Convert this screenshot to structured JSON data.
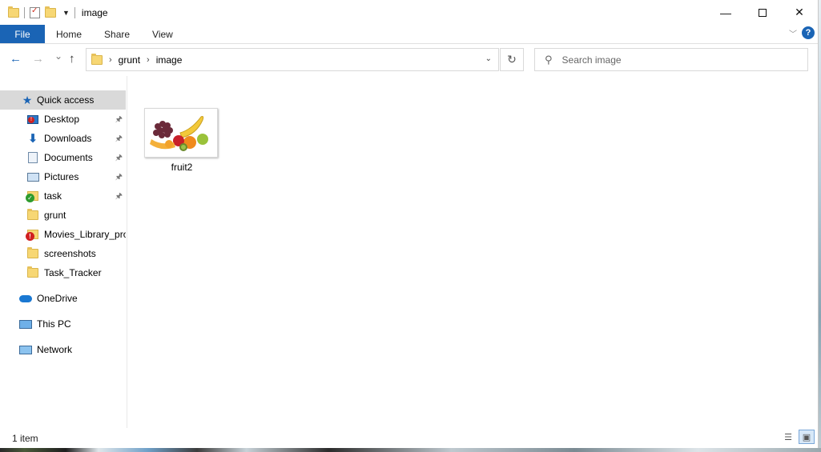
{
  "window": {
    "title": "image",
    "controls": {
      "minimize": "—",
      "maximize": "",
      "close": "✕"
    }
  },
  "ribbon": {
    "tabs": [
      "File",
      "Home",
      "Share",
      "View"
    ],
    "expand_icon": "chevron-down-icon",
    "help": "?"
  },
  "navigation": {
    "back": "←",
    "forward": "→",
    "recent": "⌄",
    "up": "↑",
    "path": [
      "grunt",
      "image"
    ],
    "separator": "›",
    "refresh": "↻",
    "search_placeholder": "Search image",
    "search_icon": "⚲"
  },
  "sidebar": {
    "quick_access": "Quick access",
    "items": [
      {
        "label": "Desktop",
        "pinned": true
      },
      {
        "label": "Downloads",
        "pinned": true
      },
      {
        "label": "Documents",
        "pinned": true
      },
      {
        "label": "Pictures",
        "pinned": true
      },
      {
        "label": "task",
        "pinned": true
      },
      {
        "label": "grunt",
        "pinned": false
      },
      {
        "label": "Movies_Library_pro",
        "pinned": false
      },
      {
        "label": "screenshots",
        "pinned": false
      },
      {
        "label": "Task_Tracker",
        "pinned": false
      }
    ],
    "onedrive": "OneDrive",
    "this_pc": "This PC",
    "network": "Network",
    "pin_glyph": "📌"
  },
  "content": {
    "files": [
      {
        "name": "fruit2",
        "type": "image"
      }
    ]
  },
  "status": {
    "item_count": "1 item"
  },
  "colors": {
    "accent": "#1a64b5",
    "selected_bg": "#d9d9d9"
  }
}
